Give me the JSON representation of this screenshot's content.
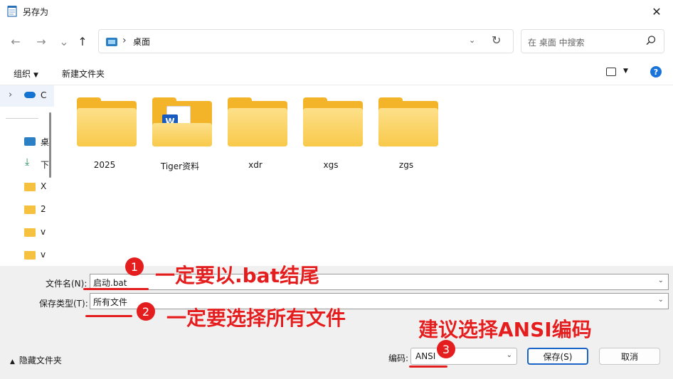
{
  "window": {
    "title": "另存为",
    "close_symbol": "✕"
  },
  "nav": {
    "back_symbol": "←",
    "forward_symbol": "→",
    "recent_symbol": "⌄",
    "up_symbol": "↑",
    "breadcrumb_sep": "›",
    "location": "桌面",
    "chevron_symbol": "⌄",
    "refresh_symbol": "↻"
  },
  "search": {
    "placeholder": "在 桌面 中搜索"
  },
  "toolbar": {
    "organize_label": "组织",
    "new_folder_label": "新建文件夹",
    "help_symbol": "?"
  },
  "sidebar": {
    "expand_symbol": "›",
    "items": [
      {
        "text": "C",
        "icon": "onedrive-icon"
      },
      {
        "text": "桌",
        "icon": "desktop-icon"
      },
      {
        "text": "下",
        "icon": "downloads-icon"
      },
      {
        "text": "X",
        "icon": "folder-icon"
      },
      {
        "text": "2",
        "icon": "folder-icon"
      },
      {
        "text": "v",
        "icon": "folder-icon"
      },
      {
        "text": "v",
        "icon": "folder-icon"
      }
    ]
  },
  "folders": [
    {
      "name": "2025",
      "has_doc": false
    },
    {
      "name": "Tiger资料",
      "has_doc": true,
      "doc_badge": "W"
    },
    {
      "name": "xdr",
      "has_doc": false
    },
    {
      "name": "xgs",
      "has_doc": false
    },
    {
      "name": "zgs",
      "has_doc": false
    }
  ],
  "save_form": {
    "filename_label": "文件名(N):",
    "filename_value": "启动.bat",
    "filetype_label": "保存类型(T):",
    "filetype_value": "所有文件",
    "dropdown_symbol": "⌄"
  },
  "footer": {
    "hide_folders_label": "隐藏文件夹",
    "hide_caret": "▲",
    "encoding_label": "编码:",
    "encoding_value": "ANSI",
    "save_button": "保存(S)",
    "cancel_button": "取消"
  },
  "annotations": [
    {
      "number": "1",
      "text": "一定要以.bat结尾"
    },
    {
      "number": "2",
      "text": "一定要选择所有文件"
    },
    {
      "number": "3",
      "text": "建议选择ANSI编码"
    }
  ],
  "colors": {
    "annotation": "#e41e1e",
    "folder": "#f3b42a",
    "accent": "#1a64c8"
  }
}
